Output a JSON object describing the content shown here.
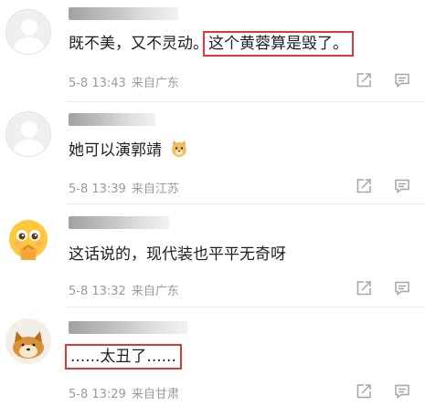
{
  "comments": [
    {
      "text_plain": "既不美，又不灵动。",
      "text_highlight": "这个黄蓉算是毁了。",
      "date": "5-8 13:43",
      "location": "来自广东"
    },
    {
      "text": "她可以演郭靖",
      "emoji": "doge-emoji",
      "date": "5-8 13:39",
      "location": "来自江苏"
    },
    {
      "text": "这话说的，现代装也平平无奇呀",
      "date": "5-8 13:32",
      "location": "来自广东"
    },
    {
      "text_highlight": "......太丑了......",
      "date": "5-8 13:29",
      "location": "来自甘肃"
    }
  ],
  "colors": {
    "highlight_border": "#d83a34",
    "meta_text": "#9a9a9a"
  },
  "icons": {
    "share": "share-edit-icon",
    "comment": "comment-bubble-icon"
  }
}
